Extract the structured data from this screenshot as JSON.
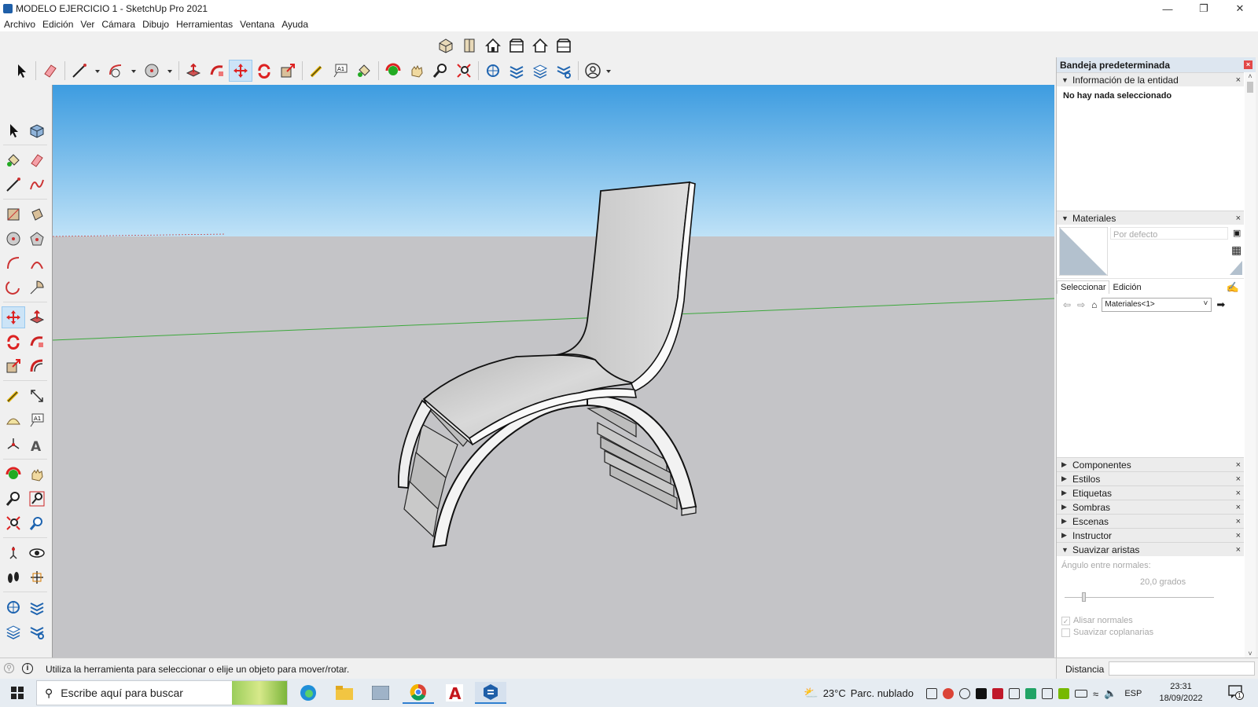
{
  "window": {
    "title": "MODELO EJERCICIO 1 - SketchUp Pro 2021",
    "controls": [
      "minimize-icon",
      "restore-icon",
      "close-icon"
    ]
  },
  "menu": [
    "Archivo",
    "Edición",
    "Ver",
    "Cámara",
    "Dibujo",
    "Herramientas",
    "Ventana",
    "Ayuda"
  ],
  "toolbar_top": {
    "views": [
      "iso-view-icon",
      "top-view-icon",
      "front-view-icon",
      "right-view-icon",
      "back-view-icon",
      "left-view-icon"
    ],
    "tools": [
      "select-icon",
      "eraser-icon",
      "line-icon",
      "arc-icon",
      "circle-icon",
      "push-pull-icon",
      "follow-me-icon",
      "move-icon",
      "rotate-icon",
      "scale-icon",
      "tape-measure-icon",
      "text-icon",
      "paint-bucket-icon",
      "orbit-icon",
      "pan-icon",
      "zoom-icon",
      "zoom-extents-icon",
      "warehouse-icon",
      "extension-icon",
      "layers-icon",
      "extension-manager-icon",
      "account-icon"
    ],
    "active_tool": "move-icon"
  },
  "toolbar_left": {
    "rows": [
      [
        "select-icon",
        "make-component-icon"
      ],
      [
        "paint-bucket-icon",
        "eraser-icon"
      ],
      [
        "line-icon",
        "freehand-icon"
      ],
      [
        "rectangle-icon",
        "rotated-rectangle-icon"
      ],
      [
        "circle-icon",
        "polygon-icon"
      ],
      [
        "arc-icon",
        "two-point-arc-icon"
      ],
      [
        "three-point-arc-icon",
        "pie-icon"
      ],
      [
        "move-icon",
        "push-pull-icon"
      ],
      [
        "rotate-icon",
        "follow-me-icon"
      ],
      [
        "scale-icon",
        "offset-icon"
      ],
      [
        "tape-measure-icon",
        "dimension-icon"
      ],
      [
        "protractor-icon",
        "text-icon"
      ],
      [
        "axes-icon",
        "3d-text-icon"
      ],
      [
        "orbit-icon",
        "pan-icon"
      ],
      [
        "zoom-icon",
        "zoom-window-icon"
      ],
      [
        "zoom-extents-icon",
        "previous-view-icon"
      ],
      [
        "position-camera-icon",
        "look-around-icon"
      ],
      [
        "walk-icon",
        "section-plane-icon"
      ],
      [
        "warehouse-icon",
        "extension-icon"
      ],
      [
        "layers-icon",
        "extension-manager-icon"
      ]
    ]
  },
  "tray": {
    "title": "Bandeja predeterminada",
    "entity_info": {
      "title": "Información de la entidad",
      "message": "No hay nada seleccionado"
    },
    "materials": {
      "title": "Materiales",
      "current": "Por defecto",
      "tab_select": "Seleccionar",
      "tab_edit": "Edición",
      "library": "Materiales<1>"
    },
    "collapsed_panels": [
      "Componentes",
      "Estilos",
      "Etiquetas",
      "Sombras",
      "Escenas",
      "Instructor"
    ],
    "soften": {
      "title": "Suavizar aristas",
      "angle_label": "Ángulo entre normales:",
      "angle_value": "20,0",
      "angle_unit": "grados",
      "smooth_normals": "Alisar normales",
      "soften_coplanar": "Suavizar coplanarias"
    }
  },
  "status": {
    "message": "Utiliza la herramienta para seleccionar o elije un objeto para mover/rotar.",
    "measure_label": "Distancia",
    "measure_value": ""
  },
  "taskbar": {
    "search_placeholder": "Escribe aquí para buscar",
    "weather_temp": "23°C",
    "weather_desc": "Parc. nublado",
    "lang": "ESP",
    "time": "23:31",
    "date": "18/09/2022",
    "notification_count": "1"
  },
  "colors": {
    "sky_top": "#3d9ce0",
    "sky_bottom": "#bfe2f7",
    "ground": "#c4c4c7",
    "accent": "#cce4f7",
    "axis_green": "#3ca83c"
  }
}
